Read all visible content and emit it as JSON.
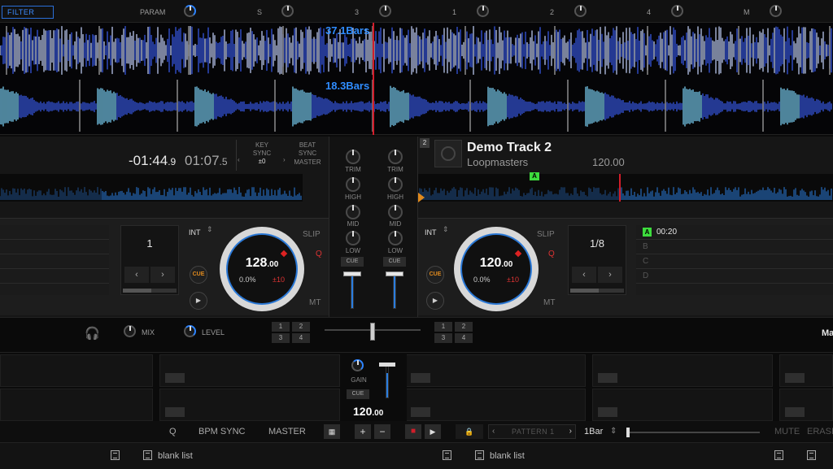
{
  "fx_bar": {
    "filter_label": "FILTER",
    "param_label": "PARAM",
    "slots": [
      "S",
      "3",
      "1",
      "2",
      "4",
      "M"
    ]
  },
  "waveform": {
    "top_bars": "37.1Bars",
    "bottom_bars": "18.3Bars"
  },
  "deck1": {
    "remaining": "-01:44",
    "remaining_frac": ".9",
    "elapsed": "01:07",
    "elapsed_frac": ".5",
    "key_sync_label": "KEY\nSYNC",
    "key_value": "±0",
    "beat_sync_label": "BEAT\nSYNC",
    "master_label": "MASTER",
    "loop_value": "1",
    "int_label": "INT",
    "slip_label": "SLIP",
    "q_label": "Q",
    "mt_label": "MT",
    "cue_label": "CUE",
    "bpm": "128",
    "bpm_frac": ".00",
    "pitch_percent": "0.0%",
    "pitch_range": "±10"
  },
  "deck2": {
    "number": "2",
    "title": "Demo Track 2",
    "artist": "Loopmasters",
    "bpm_display": "120.00",
    "hotcue_marker": "A",
    "loop_value": "1/8",
    "int_label": "INT",
    "slip_label": "SLIP",
    "q_label": "Q",
    "mt_label": "MT",
    "cue_label": "CUE",
    "bpm": "120",
    "bpm_frac": ".00",
    "pitch_percent": "0.0%",
    "pitch_range": "±10",
    "hotcues": [
      {
        "letter": "A",
        "time": "00:20"
      },
      {
        "letter": "B",
        "time": ""
      },
      {
        "letter": "C",
        "time": ""
      },
      {
        "letter": "D",
        "time": ""
      }
    ]
  },
  "mixer": {
    "trim": "TRIM",
    "high": "HIGH",
    "mid": "MID",
    "low": "LOW",
    "cue": "CUE"
  },
  "headphones": {
    "mix_label": "MIX",
    "level_label": "LEVEL"
  },
  "fx_assign": [
    "1",
    "2",
    "3",
    "4"
  ],
  "right_edge_label": "Ma",
  "sampler": {
    "gain_label": "GAIN",
    "cue_label": "CUE",
    "bpm": "120",
    "bpm_frac": ".00"
  },
  "bottom_bar": {
    "q_label": "Q",
    "bpm_sync": "BPM SYNC",
    "master": "MASTER",
    "plus": "+",
    "minus": "−",
    "pattern": "PATTERN 1",
    "bar_len": "1Bar",
    "mute": "MUTE",
    "erase": "ERASE"
  },
  "status_bar": {
    "list1": "blank list",
    "list2": "blank list"
  },
  "colors": {
    "accent_blue": "#2f8cff",
    "cue_orange": "#e08a1e",
    "hot_red": "#d21d2a",
    "hotcue_green": "#3ddc3d"
  }
}
